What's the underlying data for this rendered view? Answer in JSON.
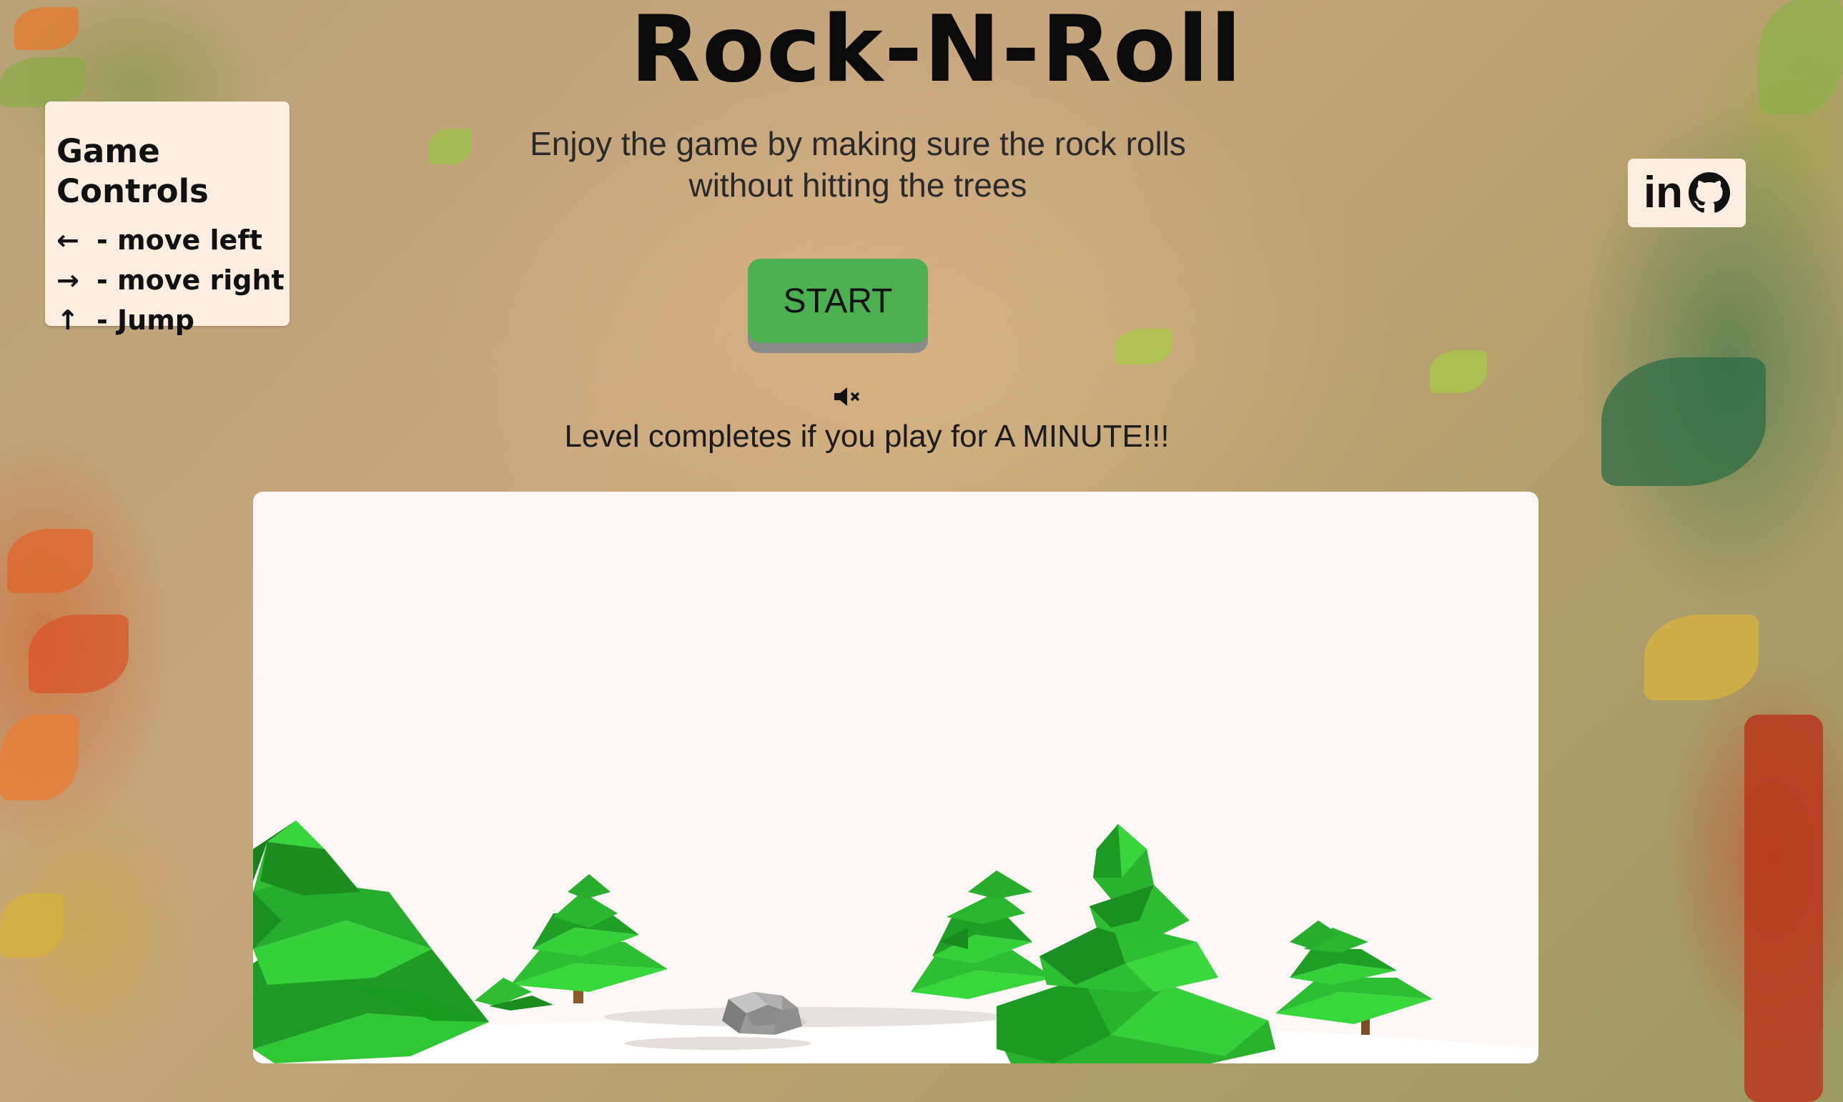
{
  "title": "Rock-N-Roll",
  "subtitle_line1": "Enjoy the game by making sure the rock rolls",
  "subtitle_line2": "without hitting the trees",
  "controls": {
    "heading": "Game Controls",
    "items": [
      {
        "arrow": "←",
        "label": "- move left"
      },
      {
        "arrow": "→",
        "label": "- move right"
      },
      {
        "arrow": "↑",
        "label": "- Jump"
      }
    ]
  },
  "social": {
    "linkedin_label": "in",
    "icons": [
      "linkedin-icon",
      "github-icon"
    ]
  },
  "start_label": "START",
  "sound_icon": "mute-icon",
  "level_note": "Level completes if you play for A MINUTE!!!",
  "colors": {
    "start_button": "#4caf50",
    "panel": "#fbeee0",
    "canvas": "#fdf8f6",
    "tree": "#2bbf32"
  }
}
